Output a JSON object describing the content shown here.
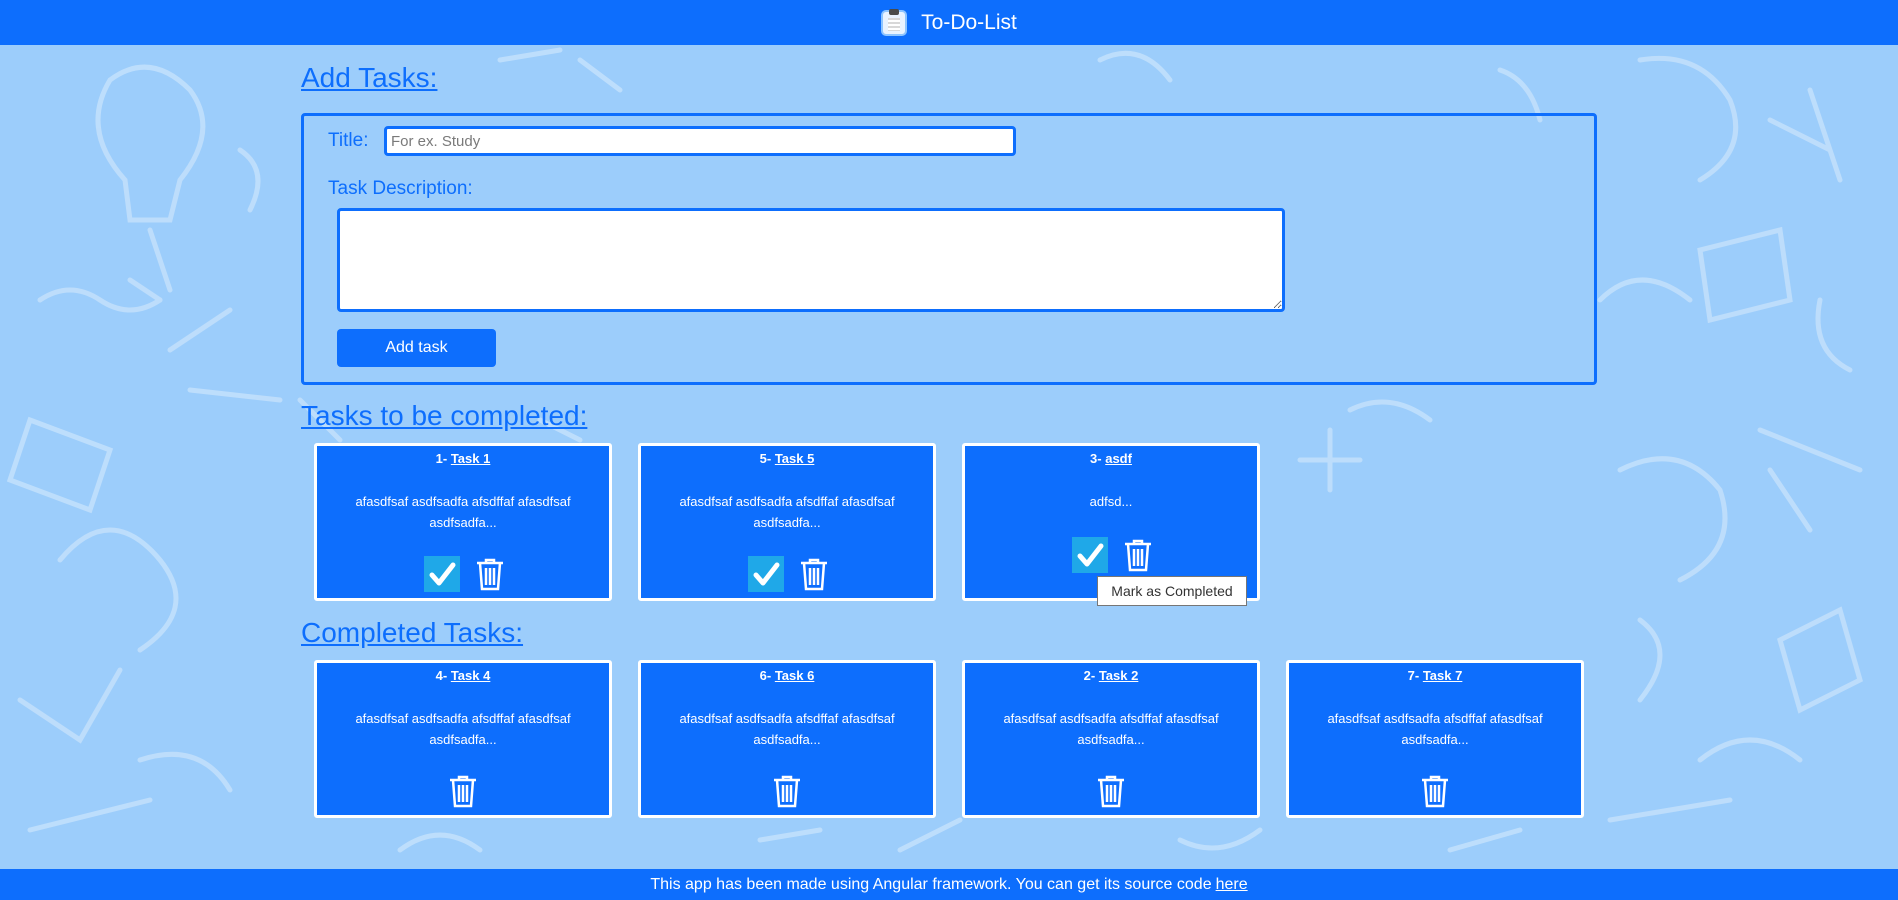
{
  "navbar": {
    "title": "To-Do-List",
    "icon": "clipboard-icon"
  },
  "add_section": {
    "heading": "Add Tasks:",
    "title_label": "Title:",
    "title_placeholder": "For ex. Study",
    "title_value": "",
    "description_label": "Task Description:",
    "description_value": "",
    "button_label": "Add task"
  },
  "pending_section": {
    "heading": "Tasks to be completed:",
    "tasks": [
      {
        "number": "1-",
        "title": "Task 1",
        "description": "afasdfsaf asdfsadfa afsdffaf afasdfsaf asdfsadfa..."
      },
      {
        "number": "5-",
        "title": "Task 5",
        "description": "afasdfsaf asdfsadfa afsdffaf afasdfsaf asdfsadfa..."
      },
      {
        "number": "3-",
        "title": "asdf",
        "description": "adfsd..."
      }
    ]
  },
  "completed_section": {
    "heading": "Completed Tasks:",
    "tasks": [
      {
        "number": "4-",
        "title": "Task 4",
        "description": "afasdfsaf asdfsadfa afsdffaf afasdfsaf asdfsadfa..."
      },
      {
        "number": "6-",
        "title": "Task 6",
        "description": "afasdfsaf asdfsadfa afsdffaf afasdfsaf asdfsadfa..."
      },
      {
        "number": "2-",
        "title": "Task 2",
        "description": "afasdfsaf asdfsadfa afsdffaf afasdfsaf asdfsadfa..."
      },
      {
        "number": "7-",
        "title": "Task 7",
        "description": "afasdfsaf asdfsadfa afsdffaf afasdfsaf asdfsadfa..."
      }
    ]
  },
  "tooltip": {
    "text": "Mark as Completed"
  },
  "footer": {
    "text": "This app has been made using Angular framework. You can get its source code",
    "link_label": "here"
  },
  "colors": {
    "primary": "#0d6efd",
    "background": "#9ccdfb",
    "check": "#1fa8e8"
  }
}
